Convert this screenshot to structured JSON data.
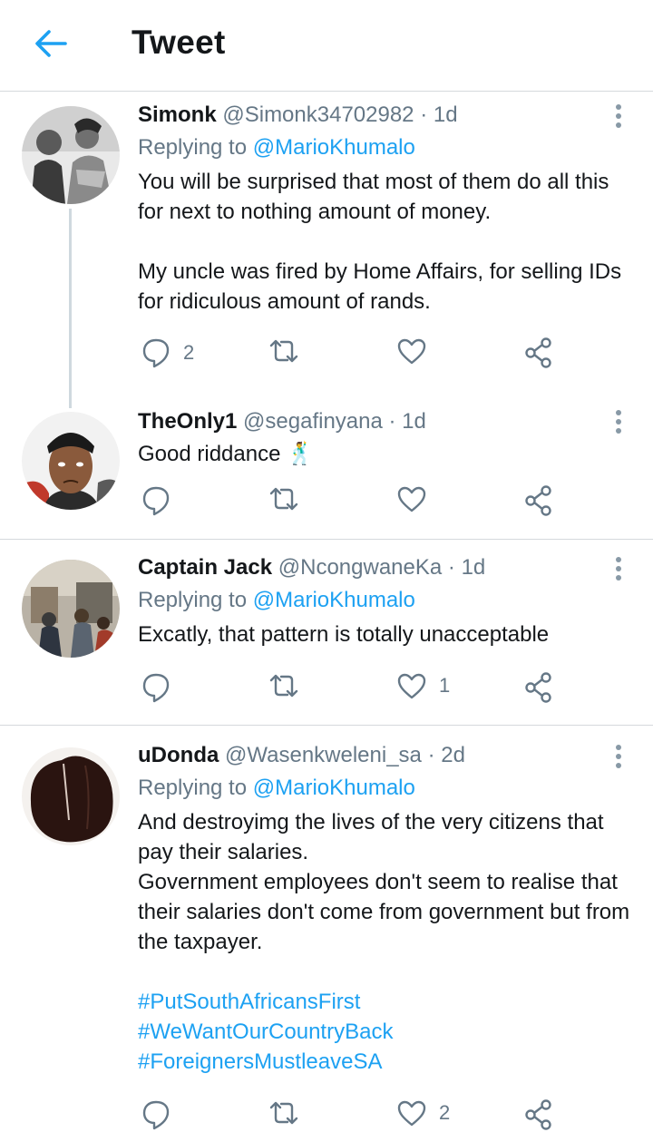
{
  "header": {
    "title": "Tweet"
  },
  "colors": {
    "accent": "#1da1f2",
    "muted": "#657786",
    "text": "#14171a",
    "divider": "#d5d9dc"
  },
  "tweets": [
    {
      "name": "Simonk",
      "handle": "@Simonk34702982",
      "dot": "·",
      "time": "1d",
      "reply_prefix": "Replying to",
      "reply_to": "@MarioKhumalo",
      "text": "You will be surprised that most of them  do all this for next to nothing amount of money.\n\nMy uncle was fired by Home Affairs, for selling IDs for ridiculous amount of rands.",
      "reply_count": "2",
      "retweet_count": "",
      "like_count": ""
    },
    {
      "name": "TheOnly1",
      "handle": "@segafinyana",
      "dot": "·",
      "time": "1d",
      "text": "Good riddance 🕺",
      "reply_count": "",
      "retweet_count": "",
      "like_count": ""
    },
    {
      "name": "Captain Jack",
      "handle": "@NcongwaneKa",
      "dot": "·",
      "time": "1d",
      "reply_prefix": "Replying to",
      "reply_to": "@MarioKhumalo",
      "text": "Excatly, that pattern is totally unacceptable",
      "reply_count": "",
      "retweet_count": "",
      "like_count": "1"
    },
    {
      "name": "uDonda",
      "handle": "@Wasenkweleni_sa",
      "dot": "·",
      "time": "2d",
      "reply_prefix": "Replying to",
      "reply_to": "@MarioKhumalo",
      "text": "And destroyimg the lives of the very citizens that pay their salaries.\nGovernment employees don't seem to realise that their salaries don't come from government but from the taxpayer.",
      "hashtags": [
        "#PutSouthAfricansFirst",
        "#WeWantOurCountryBack",
        "#ForeignersMustleaveSA"
      ],
      "reply_count": "",
      "retweet_count": "",
      "like_count": "2"
    }
  ]
}
